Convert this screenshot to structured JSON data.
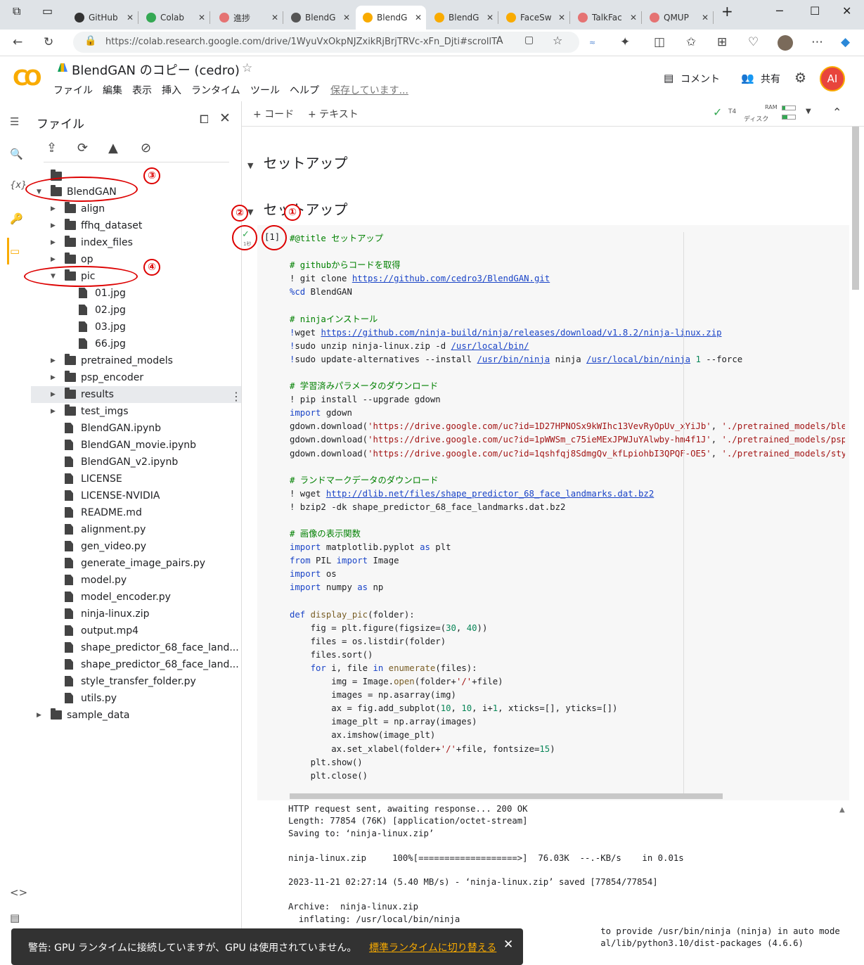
{
  "browser": {
    "tabs": [
      {
        "label": "GitHub",
        "color": "#333333"
      },
      {
        "label": "Colab",
        "color": "#34a853"
      },
      {
        "label": "進捗",
        "color": "#e57373"
      },
      {
        "label": "BlendG",
        "color": "#555555"
      },
      {
        "label": "BlendG",
        "color": "#f9ab00"
      },
      {
        "label": "BlendG",
        "color": "#f9ab00"
      },
      {
        "label": "FaceSw",
        "color": "#f9ab00"
      },
      {
        "label": "TalkFac",
        "color": "#e57373"
      },
      {
        "label": "QMUP",
        "color": "#e57373"
      }
    ],
    "url": "https://colab.research.google.com/drive/1WyuVxOkpNJZxikRjBrjTRVc-xFn_Djti#scrollT..."
  },
  "header": {
    "logo": "CO",
    "title": "BlendGAN のコピー (cedro)",
    "menu": [
      "ファイル",
      "編集",
      "表示",
      "挿入",
      "ランタイム",
      "ツール",
      "ヘルプ"
    ],
    "saving": "保存しています...",
    "comment": "コメント",
    "share": "共有",
    "avatar": "AI"
  },
  "files": {
    "title": "ファイル",
    "tree": [
      {
        "name": "BlendGAN",
        "type": "folder",
        "depth": 0,
        "open": true
      },
      {
        "name": "align",
        "type": "folder",
        "depth": 1
      },
      {
        "name": "ffhq_dataset",
        "type": "folder",
        "depth": 1
      },
      {
        "name": "index_files",
        "type": "folder",
        "depth": 1
      },
      {
        "name": "op",
        "type": "folder",
        "depth": 1
      },
      {
        "name": "pic",
        "type": "folder",
        "depth": 1,
        "open": true
      },
      {
        "name": "01.jpg",
        "type": "file",
        "depth": 2
      },
      {
        "name": "02.jpg",
        "type": "file",
        "depth": 2
      },
      {
        "name": "03.jpg",
        "type": "file",
        "depth": 2
      },
      {
        "name": "66.jpg",
        "type": "file",
        "depth": 2
      },
      {
        "name": "pretrained_models",
        "type": "folder",
        "depth": 1
      },
      {
        "name": "psp_encoder",
        "type": "folder",
        "depth": 1
      },
      {
        "name": "results",
        "type": "folder",
        "depth": 1,
        "highlight": true
      },
      {
        "name": "test_imgs",
        "type": "folder",
        "depth": 1
      },
      {
        "name": "BlendGAN.ipynb",
        "type": "file",
        "depth": 1
      },
      {
        "name": "BlendGAN_movie.ipynb",
        "type": "file",
        "depth": 1
      },
      {
        "name": "BlendGAN_v2.ipynb",
        "type": "file",
        "depth": 1
      },
      {
        "name": "LICENSE",
        "type": "file",
        "depth": 1
      },
      {
        "name": "LICENSE-NVIDIA",
        "type": "file",
        "depth": 1
      },
      {
        "name": "README.md",
        "type": "file",
        "depth": 1
      },
      {
        "name": "alignment.py",
        "type": "file",
        "depth": 1
      },
      {
        "name": "gen_video.py",
        "type": "file",
        "depth": 1
      },
      {
        "name": "generate_image_pairs.py",
        "type": "file",
        "depth": 1
      },
      {
        "name": "model.py",
        "type": "file",
        "depth": 1
      },
      {
        "name": "model_encoder.py",
        "type": "file",
        "depth": 1
      },
      {
        "name": "ninja-linux.zip",
        "type": "file",
        "depth": 1
      },
      {
        "name": "output.mp4",
        "type": "file",
        "depth": 1
      },
      {
        "name": "shape_predictor_68_face_land...",
        "type": "file",
        "depth": 1
      },
      {
        "name": "shape_predictor_68_face_land...",
        "type": "file",
        "depth": 1
      },
      {
        "name": "style_transfer_folder.py",
        "type": "file",
        "depth": 1
      },
      {
        "name": "utils.py",
        "type": "file",
        "depth": 1
      },
      {
        "name": "sample_data",
        "type": "folder",
        "depth": 0
      }
    ]
  },
  "toolbar": {
    "add_code": "+ コード",
    "add_text": "+ テキスト",
    "gpu": "T4",
    "ram": "RAM",
    "disk": "ディスク"
  },
  "notebook": {
    "section1": "セットアップ",
    "section2": "セットアップ",
    "exec_count": "[1]",
    "exec_time": "1秒"
  },
  "code_lines": [
    [
      [
        "cm",
        "#@title セットアップ"
      ]
    ],
    [],
    [
      [
        "cm",
        "# githubからコードを取得"
      ]
    ],
    [
      [
        "",
        "! git clone "
      ],
      [
        "ln",
        "https://github.com/cedro3/BlendGAN.git"
      ]
    ],
    [
      [
        "kw",
        "%cd"
      ],
      [
        "",
        " BlendGAN"
      ]
    ],
    [],
    [
      [
        "cm",
        "# ninjaインストール"
      ]
    ],
    [
      [
        "kw",
        "!"
      ],
      [
        "",
        "wget "
      ],
      [
        "ln",
        "https://github.com/ninja-build/ninja/releases/download/v1.8.2/ninja-linux.zip"
      ]
    ],
    [
      [
        "kw",
        "!"
      ],
      [
        "",
        "sudo unzip ninja-linux.zip -d "
      ],
      [
        "ln",
        "/usr/local/bin/"
      ]
    ],
    [
      [
        "kw",
        "!"
      ],
      [
        "",
        "sudo update-alternatives --install "
      ],
      [
        "ln",
        "/usr/bin/ninja"
      ],
      [
        "",
        " ninja "
      ],
      [
        "ln",
        "/usr/local/bin/ninja"
      ],
      [
        "nu",
        " 1"
      ],
      [
        "",
        " --force"
      ]
    ],
    [],
    [
      [
        "cm",
        "# 学習済みパラメータのダウンロード"
      ]
    ],
    [
      [
        "",
        "! pip install --upgrade gdown"
      ]
    ],
    [
      [
        "kw",
        "import"
      ],
      [
        "",
        " gdown"
      ]
    ],
    [
      [
        "",
        "gdown.download("
      ],
      [
        "st",
        "'https://drive.google.com/uc?id=1D27HPNOSx9kWIhc13VevRyOpUv_xYiJb'"
      ],
      [
        "",
        ", "
      ],
      [
        "st",
        "'./pretrained_models/blendgan."
      ]
    ],
    [
      [
        "",
        "gdown.download("
      ],
      [
        "st",
        "'https://drive.google.com/uc?id=1pWWSm_c75ieMExJPWJuYAlwby-hm4f1J'"
      ],
      [
        "",
        ", "
      ],
      [
        "st",
        "'./pretrained_models/psp_encod"
      ]
    ],
    [
      [
        "",
        "gdown.download("
      ],
      [
        "st",
        "'https://drive.google.com/uc?id=1qshfqj8SdmgQv_kfLpiohbI3QPQF-OE5'"
      ],
      [
        "",
        ", "
      ],
      [
        "st",
        "'./pretrained_models/style_enc"
      ]
    ],
    [],
    [
      [
        "cm",
        "# ランドマークデータのダウンロード"
      ]
    ],
    [
      [
        "",
        "! wget "
      ],
      [
        "ln",
        "http://dlib.net/files/shape_predictor_68_face_landmarks.dat.bz2"
      ]
    ],
    [
      [
        "",
        "! bzip2 -dk shape_predictor_68_face_landmarks.dat.bz2"
      ]
    ],
    [],
    [
      [
        "cm",
        "# 画像の表示関数"
      ]
    ],
    [
      [
        "kw",
        "import"
      ],
      [
        "",
        " matplotlib.pyplot "
      ],
      [
        "kw",
        "as"
      ],
      [
        "",
        " plt"
      ]
    ],
    [
      [
        "kw",
        "from"
      ],
      [
        "",
        " PIL "
      ],
      [
        "kw",
        "import"
      ],
      [
        "",
        " Image"
      ]
    ],
    [
      [
        "kw",
        "import"
      ],
      [
        "",
        " os"
      ]
    ],
    [
      [
        "kw",
        "import"
      ],
      [
        "",
        " numpy "
      ],
      [
        "kw",
        "as"
      ],
      [
        "",
        " np"
      ]
    ],
    [],
    [
      [
        "kw",
        "def"
      ],
      [
        "fn",
        " display_pic"
      ],
      [
        "",
        "(folder):"
      ]
    ],
    [
      [
        "",
        "    fig = plt.figure(figsize=("
      ],
      [
        "nu",
        "30"
      ],
      [
        "",
        ", "
      ],
      [
        "nu",
        "40"
      ],
      [
        "",
        "))"
      ]
    ],
    [
      [
        "",
        "    files = os.listdir(folder)"
      ]
    ],
    [
      [
        "",
        "    files.sort()"
      ]
    ],
    [
      [
        "kw",
        "    for"
      ],
      [
        "",
        " i, file "
      ],
      [
        "kw",
        "in"
      ],
      [
        "fn",
        " enumerate"
      ],
      [
        "",
        "(files):"
      ]
    ],
    [
      [
        "",
        "        img = Image."
      ],
      [
        "fn",
        "open"
      ],
      [
        "",
        "(folder+"
      ],
      [
        "st",
        "'/'"
      ],
      [
        "",
        "+file)"
      ]
    ],
    [
      [
        "",
        "        images = np.asarray(img)"
      ]
    ],
    [
      [
        "",
        "        ax = fig.add_subplot("
      ],
      [
        "nu",
        "10"
      ],
      [
        "",
        ", "
      ],
      [
        "nu",
        "10"
      ],
      [
        "",
        ", i+"
      ],
      [
        "nu",
        "1"
      ],
      [
        "",
        ", xticks=[], yticks=[])"
      ]
    ],
    [
      [
        "",
        "        image_plt = np.array(images)"
      ]
    ],
    [
      [
        "",
        "        ax.imshow(image_plt)"
      ]
    ],
    [
      [
        "",
        "        ax.set_xlabel(folder+"
      ],
      [
        "st",
        "'/'"
      ],
      [
        "",
        "+file, fontsize="
      ],
      [
        "nu",
        "15"
      ],
      [
        "",
        ")"
      ]
    ],
    [
      [
        "",
        "    plt.show()"
      ]
    ],
    [
      [
        "",
        "    plt.close()"
      ]
    ]
  ],
  "output_lines": [
    "HTTP request sent, awaiting response... 200 OK",
    "Length: 77854 (76K) [application/octet-stream]",
    "Saving to: ‘ninja-linux.zip’",
    "",
    "ninja-linux.zip     100%[===================>]  76.03K  --.-KB/s    in 0.01s",
    "",
    "2023-11-21 02:27:14 (5.40 MB/s) - ‘ninja-linux.zip’ saved [77854/77854]",
    "",
    "Archive:  ninja-linux.zip",
    "  inflating: /usr/local/bin/ninja",
    "                                                            to provide /usr/bin/ninja (ninja) in auto mode",
    "                                                            al/lib/python3.10/dist-packages (4.6.6)"
  ],
  "annotations": [
    "①",
    "②",
    "③",
    "④"
  ],
  "snackbar": {
    "message": "警告: GPU ランタイムに接続していますが、GPU は使用されていません。",
    "link": "標準ランタイムに切り替える",
    "close": "✕"
  },
  "colors": {
    "accent": "#f9ab00",
    "annotation": "#dd0000",
    "avatar": "#e8453c"
  }
}
